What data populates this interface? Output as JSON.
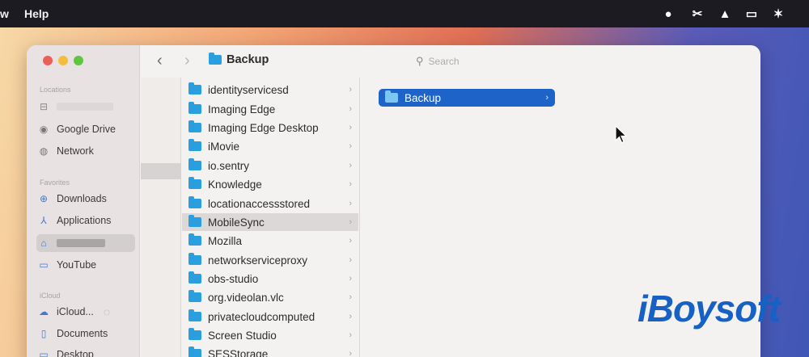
{
  "menubar": {
    "items": [
      "w",
      "Help"
    ],
    "status_icons": [
      "record-icon",
      "scissors-icon",
      "upload-icon",
      "screen-icon",
      "brightness-icon"
    ]
  },
  "window": {
    "title": "Backup",
    "search_placeholder": "Search"
  },
  "sidebar": {
    "sections": {
      "locations": "Locations",
      "favorites": "Favorites",
      "icloud": "iCloud"
    },
    "locations": [
      {
        "label": "",
        "icon": "disk-icon"
      },
      {
        "label": "Google Drive",
        "icon": "google-drive-icon"
      },
      {
        "label": "Network",
        "icon": "network-icon"
      }
    ],
    "favorites": [
      {
        "label": "Downloads",
        "icon": "downloads-icon"
      },
      {
        "label": "Applications",
        "icon": "applications-icon"
      },
      {
        "label": "",
        "icon": "home-icon",
        "selected": true
      },
      {
        "label": "YouTube",
        "icon": "folder-icon"
      }
    ],
    "icloud": [
      {
        "label": "iCloud...",
        "icon": "icloud-icon"
      },
      {
        "label": "Documents",
        "icon": "document-icon"
      },
      {
        "label": "Desktop",
        "icon": "desktop-icon"
      }
    ]
  },
  "column1": {
    "items": [
      "identityservicesd",
      "Imaging Edge",
      "Imaging Edge Desktop",
      "iMovie",
      "io.sentry",
      "Knowledge",
      "locationaccessstored",
      "MobileSync",
      "Mozilla",
      "networkserviceproxy",
      "obs-studio",
      "org.videolan.vlc",
      "privatecloudcomputed",
      "Screen Studio",
      "SESStorage"
    ],
    "selected": "MobileSync"
  },
  "column2": {
    "items": [
      "Backup"
    ],
    "selected": "Backup"
  },
  "watermark": {
    "text": "iBoysoft"
  },
  "colors": {
    "accent": "#1d63c8",
    "folder": "#2a9fe0",
    "menubar": "#1c1b22"
  }
}
